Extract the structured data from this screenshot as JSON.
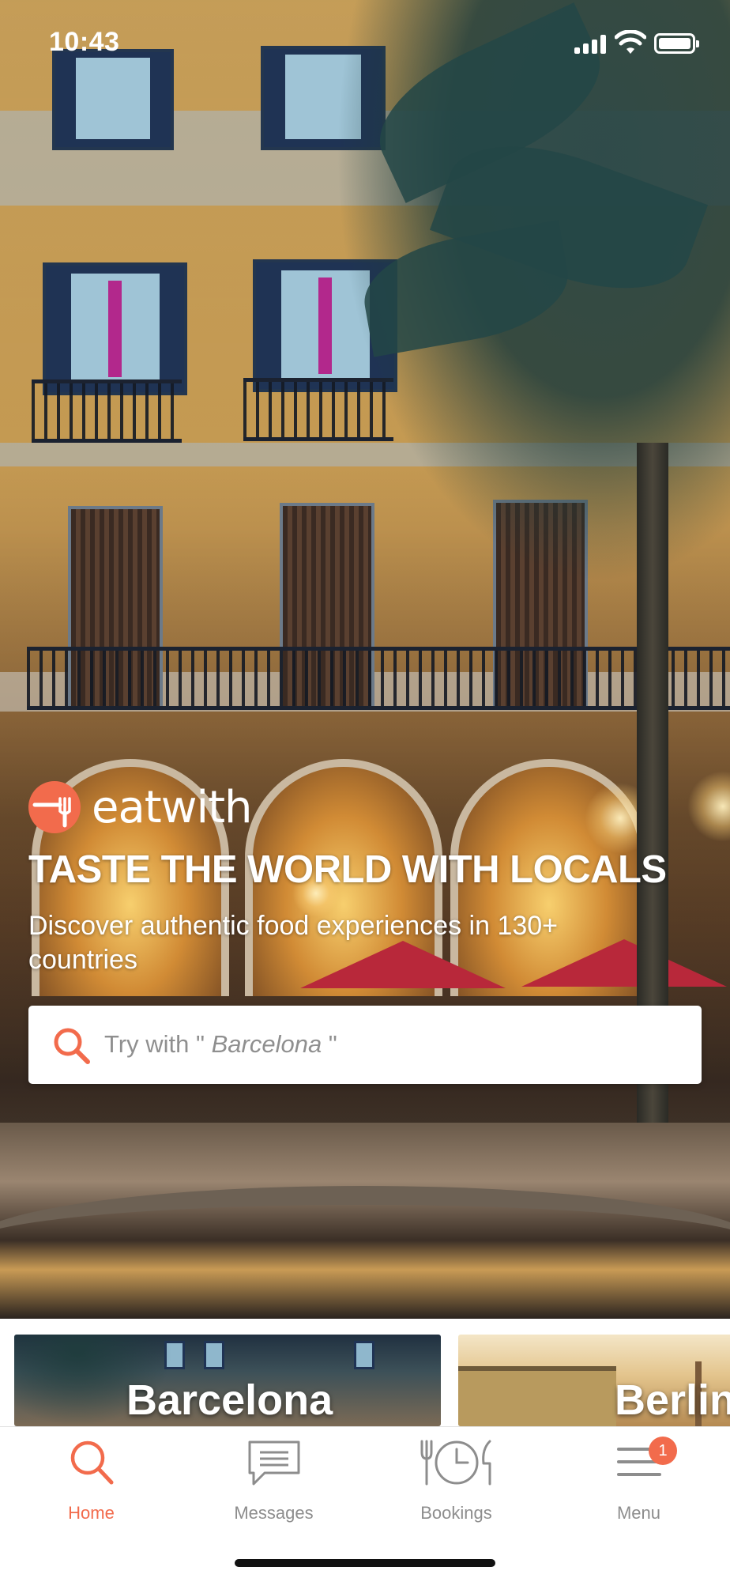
{
  "status_bar": {
    "time": "10:43"
  },
  "brand": {
    "name": "eatwith",
    "accent_color": "#F26B4C",
    "logo_icon": "fork-circle-icon"
  },
  "hero": {
    "headline": "TASTE THE WORLD WITH LOCALS",
    "subtitle": "Discover authentic food experiences in 130+ countries"
  },
  "search": {
    "prefix": "Try with \" ",
    "example_city": "Barcelona",
    "suffix": " \"",
    "icon": "search-icon"
  },
  "cities": [
    {
      "name": "Barcelona"
    },
    {
      "name": "Berlin"
    }
  ],
  "tabs": [
    {
      "label": "Home",
      "icon": "search-icon",
      "active": true
    },
    {
      "label": "Messages",
      "icon": "message-icon",
      "active": false
    },
    {
      "label": "Bookings",
      "icon": "cutlery-clock-icon",
      "active": false
    },
    {
      "label": "Menu",
      "icon": "hamburger-menu-icon",
      "active": false,
      "badge": "1"
    }
  ]
}
